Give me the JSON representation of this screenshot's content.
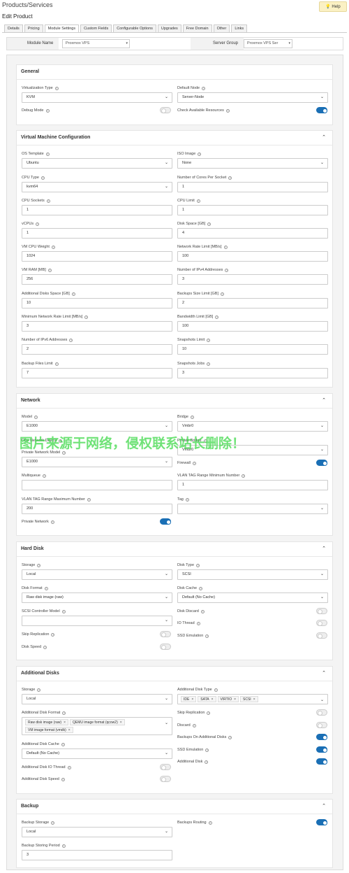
{
  "page": {
    "title": "Products/Services",
    "subtitle": "Edit Product",
    "help_label": "Help"
  },
  "tabs": [
    "Details",
    "Pricing",
    "Module Settings",
    "Custom Fields",
    "Configurable Options",
    "Upgrades",
    "Free Domain",
    "Other",
    "Links"
  ],
  "module": {
    "module_label": "Module Name",
    "module_value": "Proxmox VPS",
    "server_group_label": "Server Group",
    "server_group_value": "Proxmox VPS Ser"
  },
  "general": {
    "title": "General",
    "virtualization_type": {
      "label": "Virtualization Type",
      "value": "KVM"
    },
    "default_node": {
      "label": "Default Node",
      "value": "Server-Node"
    },
    "debug_mode": {
      "label": "Debug Mode",
      "on": false
    },
    "check_resources": {
      "label": "Check Available Resources",
      "on": true
    }
  },
  "vm": {
    "title": "Virtual Machine Configuration",
    "os_template": {
      "label": "OS Template",
      "value": "Ubuntu"
    },
    "iso_image": {
      "label": "ISO Image",
      "value": "None"
    },
    "cpu_type": {
      "label": "CPU Type",
      "value": "kvm64"
    },
    "cores": {
      "label": "Number of Cores Per Socket",
      "value": "1"
    },
    "cpu_sockets": {
      "label": "CPU Sockets",
      "value": "1"
    },
    "cpu_limit": {
      "label": "CPU Limit",
      "value": "1"
    },
    "vcpus": {
      "label": "vCPUs",
      "value": "1"
    },
    "disk_space": {
      "label": "Disk Space [GB]",
      "value": "4"
    },
    "vm_cpu_weight": {
      "label": "VM CPU Weight",
      "value": "1024"
    },
    "net_rate_limit": {
      "label": "Network Rate Limit [MB/s]",
      "value": "100"
    },
    "vm_ram": {
      "label": "VM RAM [MB]",
      "value": "256"
    },
    "ipv4": {
      "label": "Number of IPv4 Addresses",
      "value": "3"
    },
    "add_disk_space": {
      "label": "Additional Disks Space [GB]",
      "value": "10"
    },
    "backups_size": {
      "label": "Backups Size Limit [GB]",
      "value": "2"
    },
    "min_net_rate": {
      "label": "Minimum Network Rate Limit [MB/s]",
      "value": "3"
    },
    "bandwidth": {
      "label": "Bandwidth Limit [GB]",
      "value": "100"
    },
    "ipv6": {
      "label": "Number of IPv6 Addresses",
      "value": "2"
    },
    "snapshots_limit": {
      "label": "Snapshots Limit",
      "value": "10"
    },
    "backup_files": {
      "label": "Backup Files Limit",
      "value": "7"
    },
    "snapshots_jobs": {
      "label": "Snapshots Jobs",
      "value": "3"
    }
  },
  "network": {
    "title": "Network",
    "model": {
      "label": "Model",
      "value": "E1000"
    },
    "bridge": {
      "label": "Bridge",
      "value": "Vmbr0"
    },
    "one_network_device": {
      "label": "One Network Device"
    },
    "private_bridge": {
      "label": "Private Bridge",
      "value": "Vmbr0"
    },
    "private_model": {
      "label": "Private Network Model",
      "value": "E1000"
    },
    "firewall": {
      "label": "Firewall",
      "on": true
    },
    "multiqueue": {
      "label": "Multiqueue",
      "value": ""
    },
    "vlan_min": {
      "label": "VLAN TAG Range Minimum Number",
      "value": "1"
    },
    "vlan_max": {
      "label": "VLAN TAG Range Maximum Number",
      "value": "200"
    },
    "tag": {
      "label": "Tag",
      "value": ""
    },
    "private_network": {
      "label": "Private Network",
      "on": true
    }
  },
  "hard_disk": {
    "title": "Hard Disk",
    "storage": {
      "label": "Storage",
      "value": "Local"
    },
    "disk_type": {
      "label": "Disk Type",
      "value": "SCSI"
    },
    "disk_format": {
      "label": "Disk Format",
      "value": "Raw disk image (raw)"
    },
    "disk_cache": {
      "label": "Disk Cache",
      "value": "Default (No Cache)"
    },
    "scsi_model": {
      "label": "SCSI Controller Model",
      "value": ""
    },
    "disk_discard": {
      "label": "Disk Discard",
      "on": false
    },
    "io_thread": {
      "label": "IO Thread",
      "on": false
    },
    "skip_replication": {
      "label": "Skip Replication",
      "on": false
    },
    "ssd_emulation": {
      "label": "SSD Emulation",
      "on": false
    },
    "disk_speed": {
      "label": "Disk Speed",
      "on": false
    }
  },
  "additional_disks": {
    "title": "Additional Disks",
    "storage": {
      "label": "Storage",
      "value": "Local"
    },
    "disk_type": {
      "label": "Additional Disk Type",
      "chips": [
        "IDE",
        "SATA",
        "VIRTIO",
        "SCSI"
      ]
    },
    "disk_format": {
      "label": "Additional Disk Format",
      "chips": [
        "Raw disk image (raw)",
        "QEMU image format (qcow2)",
        "VM image format (vmdk)"
      ]
    },
    "skip_replication": {
      "label": "Skip Replication",
      "on": false
    },
    "discard": {
      "label": "Discard",
      "on": false
    },
    "disk_cache": {
      "label": "Additional Disk Cache",
      "value": "Default (No Cache)"
    },
    "backups_on": {
      "label": "Backups On Additional Disks",
      "on": true
    },
    "ssd_emulation": {
      "label": "SSD Emulation",
      "on": true
    },
    "io_thread": {
      "label": "Additional Disk IO Thread",
      "on": false
    },
    "additional_disk": {
      "label": "Additional Disk",
      "on": true
    },
    "disk_speed": {
      "label": "Additional Disk Speed",
      "on": false
    }
  },
  "backup": {
    "title": "Backup",
    "storage": {
      "label": "Backup Storage",
      "value": "Local"
    },
    "routing": {
      "label": "Backups Routing",
      "on": true
    },
    "period": {
      "label": "Backup Storing Period",
      "value": "3"
    }
  },
  "watermark": "图片来源于网络，侵权联系站长删除！",
  "colors": {
    "accent": "#1a6fb5",
    "help_bg": "#fbf1c4",
    "watermark": "#3fd94a"
  }
}
